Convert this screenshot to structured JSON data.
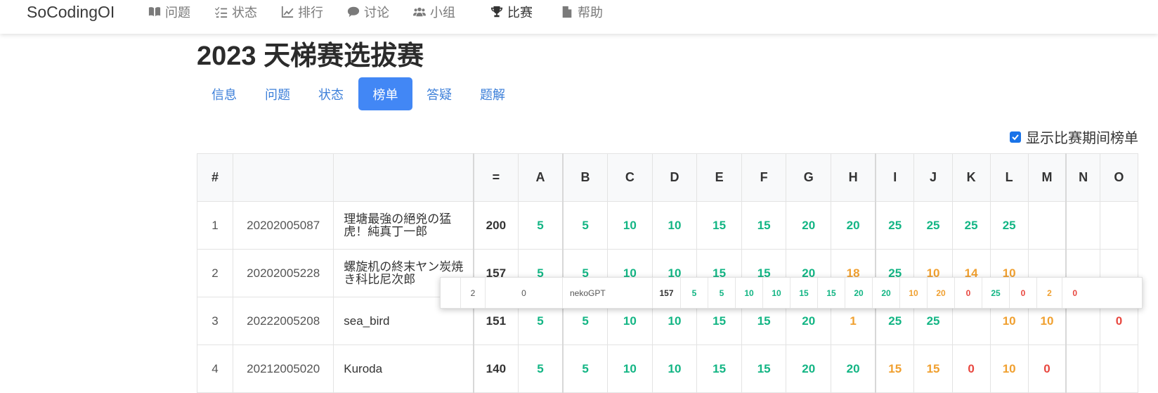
{
  "navbar": {
    "brand": "SoCodingOI",
    "items": [
      {
        "label": "问题",
        "icon": "book-icon"
      },
      {
        "label": "状态",
        "icon": "tasks-icon"
      },
      {
        "label": "排行",
        "icon": "chart-line-icon"
      },
      {
        "label": "讨论",
        "icon": "comment-icon"
      },
      {
        "label": "小组",
        "icon": "users-icon"
      },
      {
        "label": "比赛",
        "icon": "trophy-icon",
        "active": true
      },
      {
        "label": "帮助",
        "icon": "file-icon"
      }
    ]
  },
  "contest": {
    "title": "2023 天梯赛选拔赛",
    "tabs": [
      "信息",
      "问题",
      "状态",
      "榜单",
      "答疑",
      "题解"
    ],
    "active_tab": "榜单"
  },
  "options": {
    "show_during_contest_label": "显示比赛期间榜单",
    "show_during_contest_checked": true
  },
  "colors": {
    "accent": "#4287f5",
    "accepted": "#13b584",
    "partial": "#f0a030",
    "zero": "#e8473f"
  },
  "ranklist": {
    "headers": {
      "rank": "#",
      "uid": "",
      "user": "",
      "total": "=",
      "problems": [
        "A",
        "B",
        "C",
        "D",
        "E",
        "F",
        "G",
        "H",
        "I",
        "J",
        "K",
        "L",
        "M",
        "N",
        "O"
      ]
    },
    "rows": [
      {
        "rank": "1",
        "uid": "20202005087",
        "user": "理塘最強の絕兇の猛虎！純真丁一郎",
        "total": "200",
        "scores": [
          "5",
          "5",
          "10",
          "10",
          "15",
          "15",
          "20",
          "20",
          "25",
          "25",
          "25",
          "25",
          "",
          "",
          ""
        ],
        "status": [
          "g",
          "g",
          "g",
          "g",
          "g",
          "g",
          "g",
          "g",
          "g",
          "g",
          "g",
          "g",
          "",
          "",
          ""
        ]
      },
      {
        "rank": "2",
        "uid": "20202005228",
        "user": "螺旋机の終末ヤン炭焼き科比尼次郎",
        "total": "157",
        "scores": [
          "5",
          "5",
          "10",
          "10",
          "15",
          "15",
          "20",
          "18",
          "25",
          "10",
          "14",
          "10",
          "",
          "",
          ""
        ],
        "status": [
          "g",
          "g",
          "g",
          "g",
          "g",
          "g",
          "g",
          "o",
          "g",
          "o",
          "o",
          "o",
          "",
          "",
          ""
        ]
      },
      {
        "rank": "3",
        "uid": "20222005208",
        "user": "sea_bird",
        "total": "151",
        "scores": [
          "5",
          "5",
          "10",
          "10",
          "15",
          "15",
          "20",
          "1",
          "25",
          "25",
          "",
          "10",
          "10",
          "",
          "0"
        ],
        "status": [
          "g",
          "g",
          "g",
          "g",
          "g",
          "g",
          "g",
          "o",
          "g",
          "g",
          "",
          "o",
          "o",
          "",
          "r"
        ]
      },
      {
        "rank": "4",
        "uid": "20212005020",
        "user": "Kuroda",
        "total": "140",
        "scores": [
          "5",
          "5",
          "10",
          "10",
          "15",
          "15",
          "20",
          "20",
          "15",
          "15",
          "0",
          "10",
          "0",
          "",
          ""
        ],
        "status": [
          "g",
          "g",
          "g",
          "g",
          "g",
          "g",
          "g",
          "g",
          "o",
          "o",
          "r",
          "o",
          "r",
          "",
          ""
        ]
      }
    ]
  },
  "floating_row": {
    "rank": "2",
    "uid": "0",
    "user": "nekoGPT",
    "total": "157",
    "scores": [
      "5",
      "5",
      "10",
      "10",
      "15",
      "15",
      "20",
      "20",
      "10",
      "20",
      "0",
      "25",
      "0",
      "2",
      "0"
    ],
    "status": [
      "g",
      "g",
      "g",
      "g",
      "g",
      "g",
      "g",
      "g",
      "o",
      "o",
      "r",
      "g",
      "r",
      "o",
      "r"
    ]
  }
}
